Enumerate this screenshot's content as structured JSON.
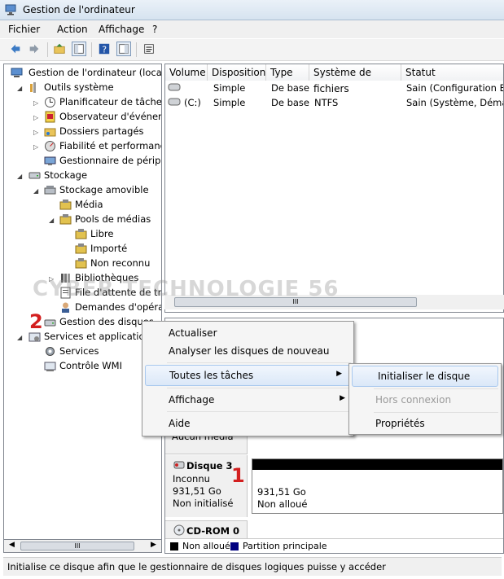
{
  "window": {
    "title": "Gestion de l'ordinateur"
  },
  "menu": [
    "Fichier",
    "Action",
    "Affichage",
    "?"
  ],
  "tree": [
    {
      "label": "Gestion de l'ordinateur (local)"
    },
    {
      "label": "Outils système"
    },
    {
      "label": "Planificateur de tâches"
    },
    {
      "label": "Observateur d'événeme"
    },
    {
      "label": "Dossiers partagés"
    },
    {
      "label": "Fiabilité et performance"
    },
    {
      "label": "Gestionnaire de périphé"
    },
    {
      "label": "Stockage"
    },
    {
      "label": "Stockage amovible"
    },
    {
      "label": "Média"
    },
    {
      "label": "Pools de médias"
    },
    {
      "label": "Libre"
    },
    {
      "label": "Importé"
    },
    {
      "label": "Non reconnu"
    },
    {
      "label": "Bibliothèques"
    },
    {
      "label": "File d'attente de trav"
    },
    {
      "label": "Demandes d'opérati"
    },
    {
      "label": "Gestion des disques"
    },
    {
      "label": "Services et applications"
    },
    {
      "label": "Services"
    },
    {
      "label": "Contrôle WMI"
    }
  ],
  "volumes": {
    "columns": [
      "Volume",
      "Disposition",
      "Type",
      "Système de fichiers",
      "Statut"
    ],
    "rows": [
      [
        "",
        "Simple",
        "De base",
        "",
        "Sain (Configuration EIS"
      ],
      [
        "(C:)",
        "Simple",
        "De base",
        "NTFS",
        "Sain (Système, Démarr"
      ]
    ]
  },
  "context_menu": {
    "items": [
      "Actualiser",
      "Analyser les disques de nouveau",
      "Toutes les tâches",
      "Affichage",
      "Aide"
    ]
  },
  "submenu": {
    "items": [
      "Initialiser le disque",
      "Hors connexion",
      "Propriétés"
    ]
  },
  "disks": {
    "partial_label": "Aucun média",
    "disk3": {
      "name": "Disque 3",
      "type": "Inconnu",
      "size": "931,51 Go",
      "status": "Non initialisé",
      "region_size": "931,51 Go",
      "region_state": "Non alloué"
    },
    "cdrom": {
      "name": "CD-ROM 0"
    }
  },
  "legend": [
    "Non alloué",
    "Partition principale"
  ],
  "colors": {
    "unallocated": "#000000",
    "primary_partition": "#000080",
    "annotation": "#d31f1f"
  },
  "annotations": [
    "1",
    "2"
  ],
  "watermark": "CYBER TECHNOLOGIE 56",
  "scroll_glyph": "III",
  "status": "Initialise ce disque afin que le gestionnaire de disques logiques puisse y accéder"
}
